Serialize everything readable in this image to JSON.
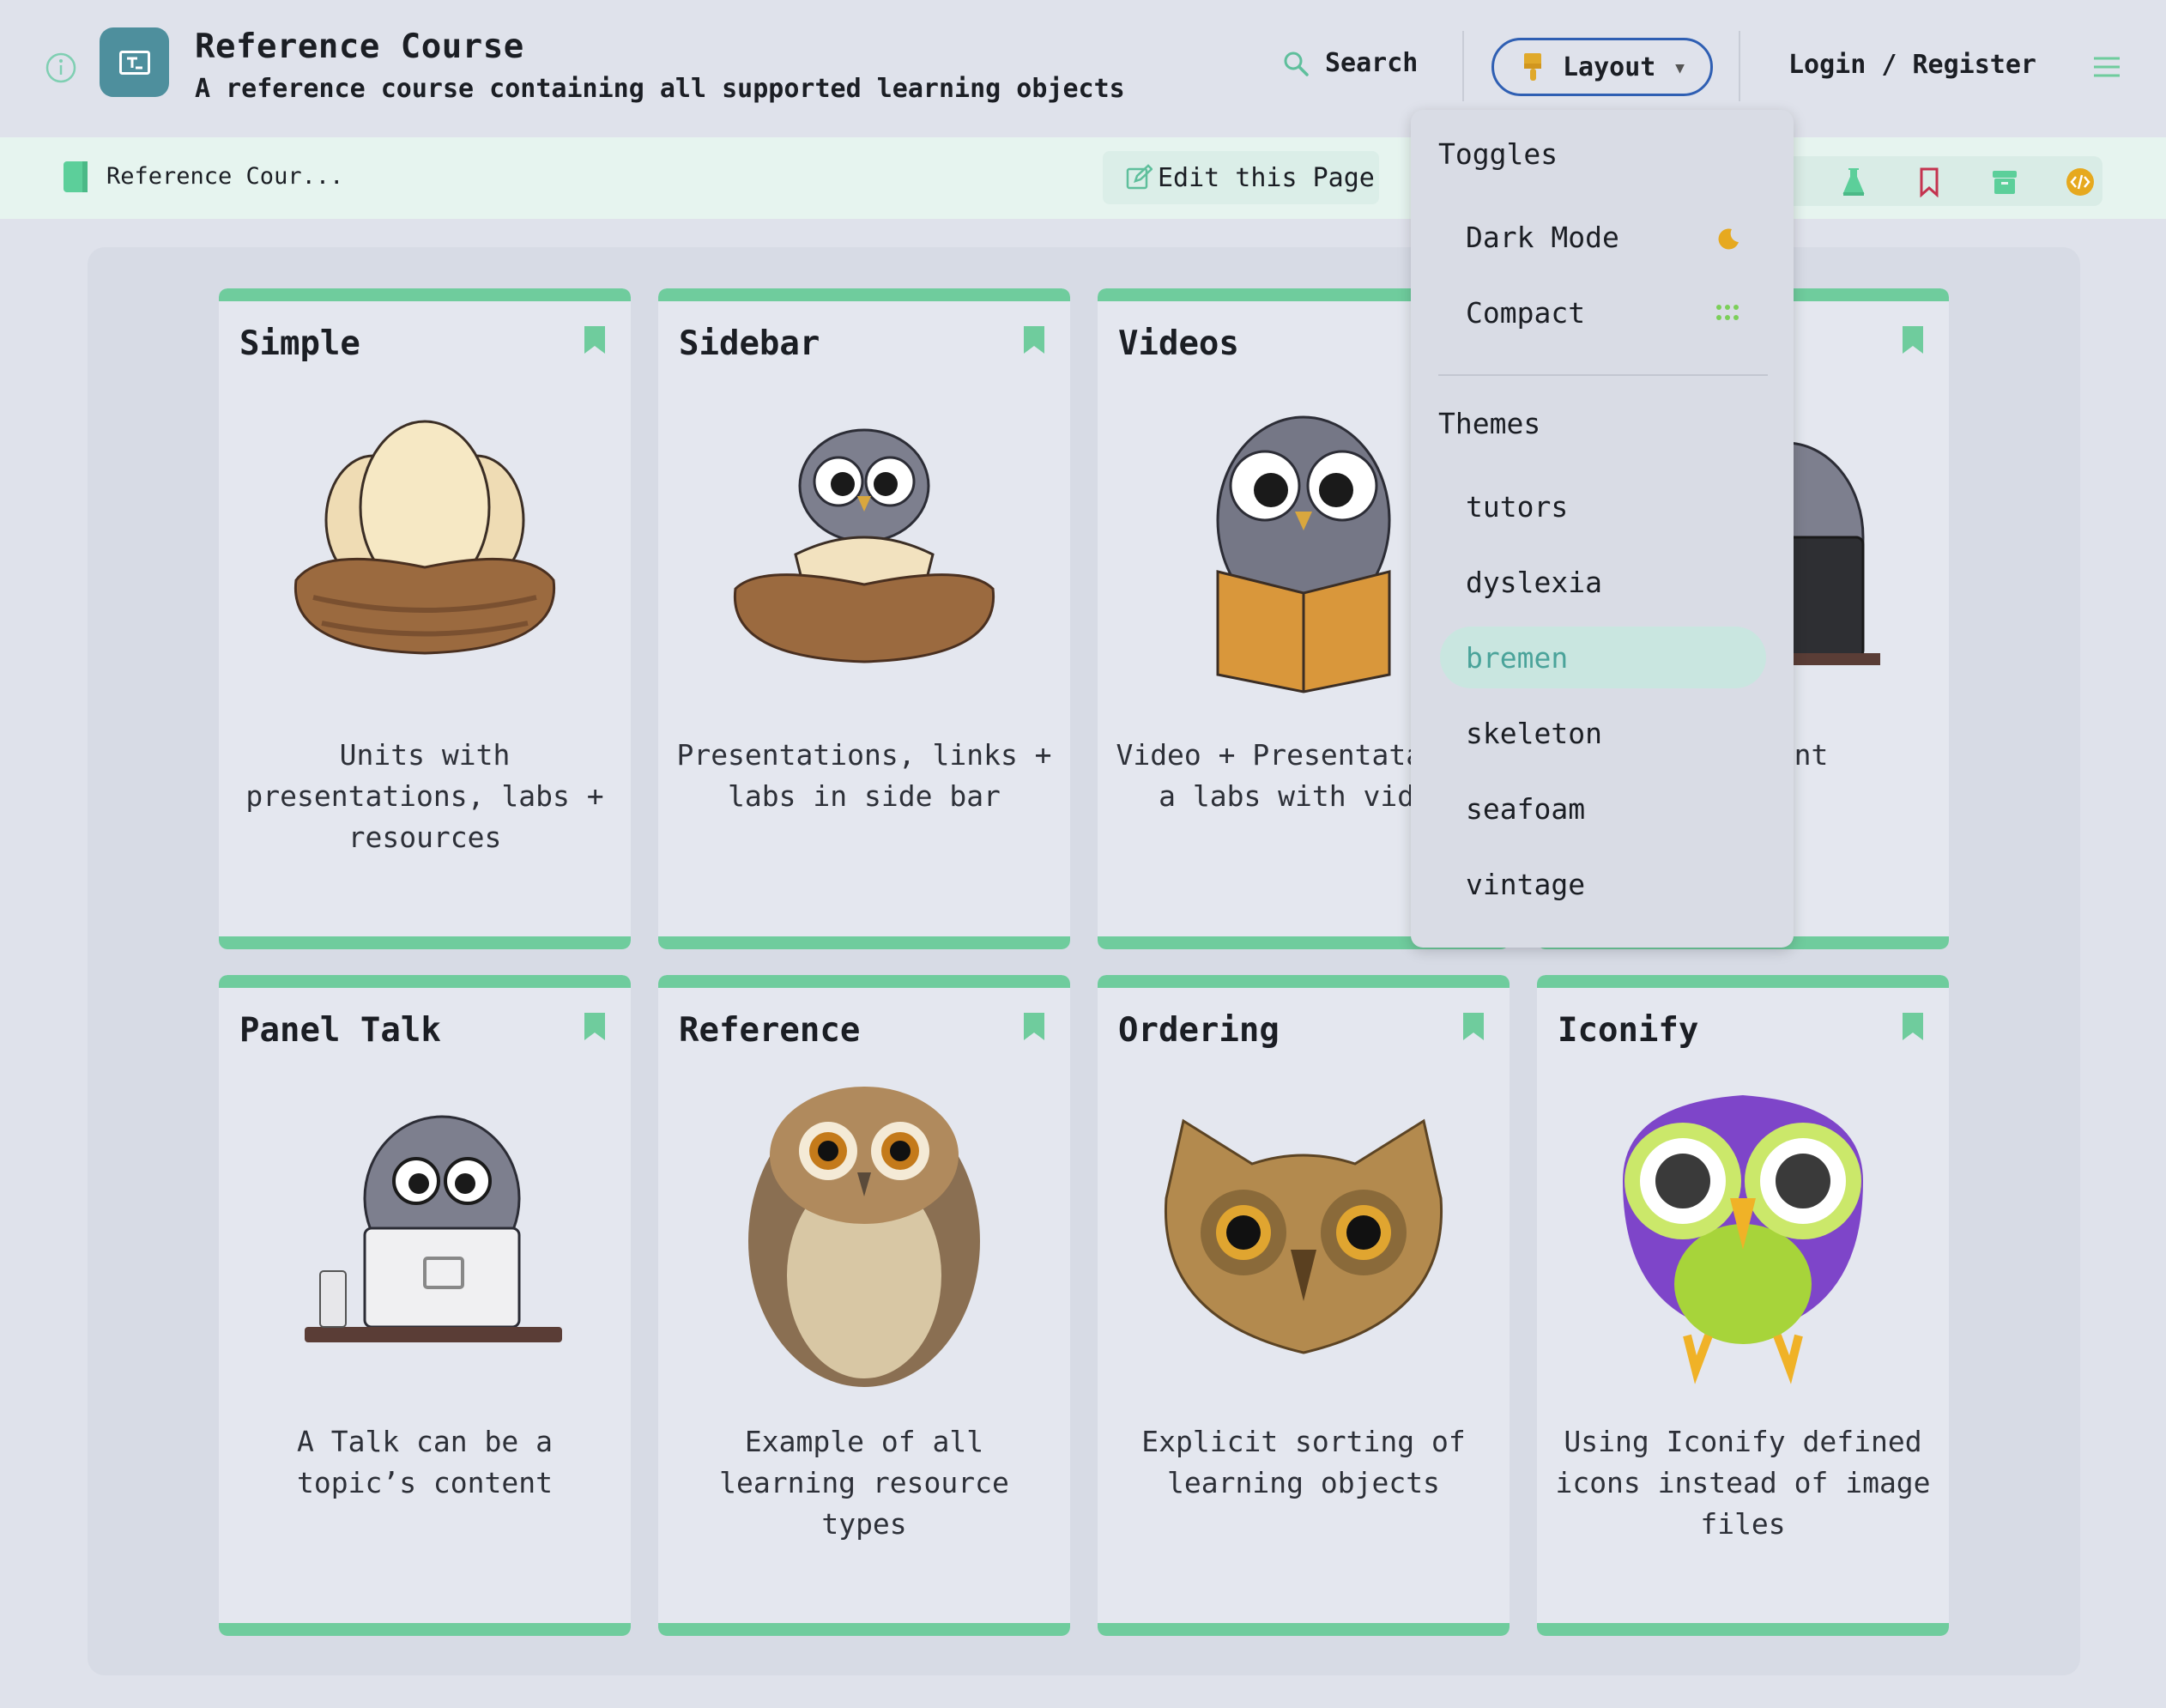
{
  "header": {
    "title": "Reference Course",
    "subtitle": "A reference course containing all supported learning objects",
    "search_label": "Search",
    "layout_label": "Layout",
    "login_label": "Login / Register"
  },
  "subbar": {
    "breadcrumb": "Reference Cour...",
    "edit_label": "Edit this Page"
  },
  "dropdown": {
    "toggles_heading": "Toggles",
    "toggles": [
      {
        "label": "Dark Mode",
        "icon": "moon-icon"
      },
      {
        "label": "Compact",
        "icon": "dots-grid-icon"
      }
    ],
    "themes_heading": "Themes",
    "themes": [
      "tutors",
      "dyslexia",
      "bremen",
      "skeleton",
      "seafoam",
      "vintage"
    ],
    "active_theme": "bremen"
  },
  "cards": [
    {
      "title": "Simple",
      "desc": "Units with presentations, labs + resources",
      "image": "eggs-nest-illustration"
    },
    {
      "title": "Sidebar",
      "desc": "Presentations, links + labs in side bar",
      "image": "owl-hatching-illustration"
    },
    {
      "title": "Videos",
      "desc": "Video + Presentataions a labs with videc",
      "image": "owl-reading-book-illustration"
    },
    {
      "title": "",
      "desc": "be a ntent",
      "image": "owl-laptop-illustration"
    },
    {
      "title": "Panel Talk",
      "desc": "A Talk can be a topic’s content",
      "image": "owl-desk-laptop-illustration"
    },
    {
      "title": "Reference",
      "desc": "Example of all learning resource types",
      "image": "realistic-owl-illustration"
    },
    {
      "title": "Ordering",
      "desc": "Explicit sorting of learning objects",
      "image": "owl-face-illustration"
    },
    {
      "title": "Iconify",
      "desc": "Using Iconify defined icons instead of image files",
      "image": "purple-owl-icon"
    }
  ],
  "colors": {
    "accent": "#6fcc9d",
    "layout_border": "#2f5fb3",
    "logo": "#4e8f9d",
    "active_theme_text": "#4aa39a"
  }
}
